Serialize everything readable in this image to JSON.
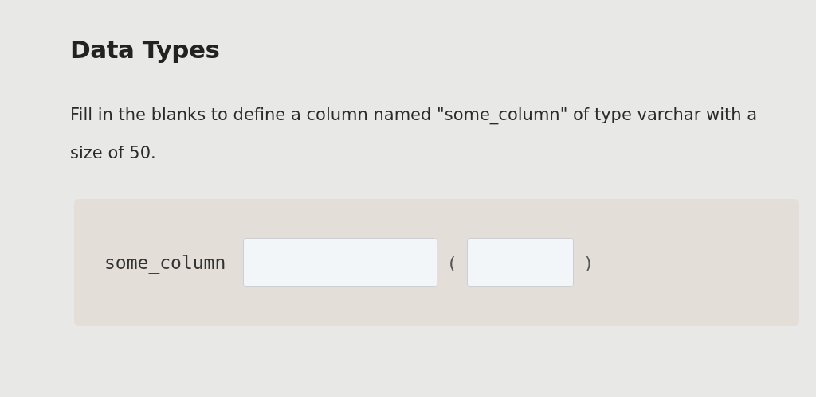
{
  "title": "Data Types",
  "instructions": "Fill in the blanks to define a column named \"some_column\" of type varchar with a size of 50.",
  "exercise": {
    "code_prefix": "some_column",
    "blanks": [
      {
        "kind": "wide"
      },
      {
        "kind": "narrow"
      }
    ],
    "open_paren": "(",
    "close_paren": ")"
  }
}
